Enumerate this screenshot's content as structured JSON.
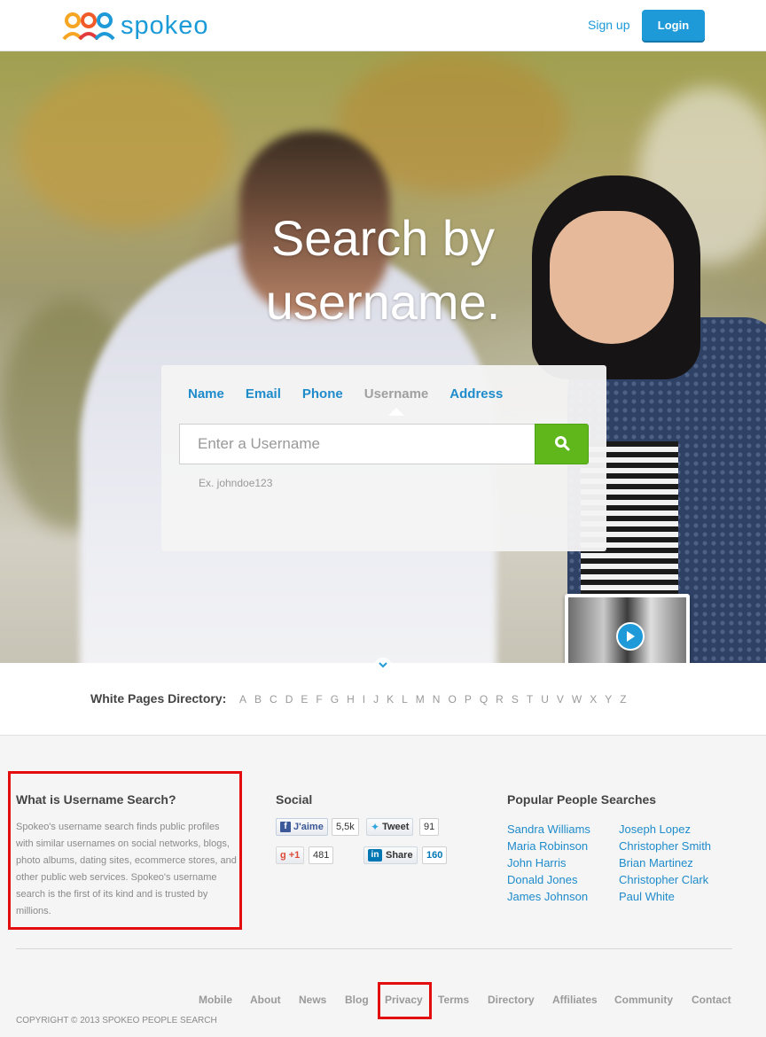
{
  "header": {
    "brand": "spokeo",
    "signup_label": "Sign up",
    "login_label": "Login"
  },
  "hero": {
    "headline_line1": "Search by",
    "headline_line2": "username.",
    "tabs": [
      {
        "label": "Name",
        "active": false
      },
      {
        "label": "Email",
        "active": false
      },
      {
        "label": "Phone",
        "active": false
      },
      {
        "label": "Username",
        "active": true
      },
      {
        "label": "Address",
        "active": false
      }
    ],
    "search_placeholder": "Enter a Username",
    "search_hint": "Ex. johndoe123",
    "search_icon": "search-icon",
    "video_icon": "play-icon"
  },
  "directory": {
    "label": "White Pages Directory:",
    "letters": [
      "A",
      "B",
      "C",
      "D",
      "E",
      "F",
      "G",
      "H",
      "I",
      "J",
      "K",
      "L",
      "M",
      "N",
      "O",
      "P",
      "Q",
      "R",
      "S",
      "T",
      "U",
      "V",
      "W",
      "X",
      "Y",
      "Z"
    ]
  },
  "about": {
    "title": "What is Username Search?",
    "text": "Spokeo's username search finds public profiles with similar usernames on social networks, blogs, photo albums, dating sites, ecommerce stores, and other public web services. Spokeo's username search is the first of its kind and is trusted by millions."
  },
  "social": {
    "title": "Social",
    "facebook_label": "J'aime",
    "facebook_count": "5,5k",
    "twitter_label": "Tweet",
    "twitter_count": "91",
    "gplus_label": "+1",
    "gplus_count": "481",
    "linkedin_label": "Share",
    "linkedin_count": "160"
  },
  "popular": {
    "title": "Popular People Searches",
    "col1": [
      "Sandra Williams",
      "Maria Robinson",
      "John Harris",
      "Donald Jones",
      "James Johnson"
    ],
    "col2": [
      "Joseph Lopez",
      "Christopher Smith",
      "Brian Martinez",
      "Christopher Clark",
      "Paul White"
    ]
  },
  "footer": {
    "links": [
      "Mobile",
      "About",
      "News",
      "Blog",
      "Privacy",
      "Terms",
      "Directory",
      "Affiliates",
      "Community",
      "Contact"
    ],
    "copyright": "COPYRIGHT © 2013 SPOKEO PEOPLE SEARCH"
  },
  "colors": {
    "brand_blue": "#1e9ad8",
    "search_green": "#5fb71c",
    "annotation_red": "#e30d0d"
  }
}
